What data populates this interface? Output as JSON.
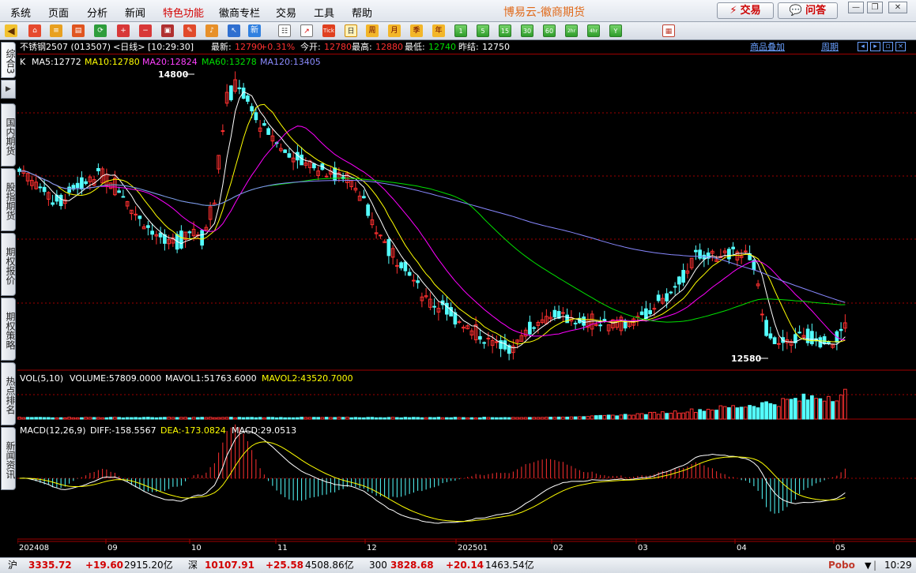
{
  "menu": [
    "系统",
    "页面",
    "分析",
    "新闻",
    "特色功能",
    "徽商专栏",
    "交易",
    "工具",
    "帮助"
  ],
  "menu_highlight": "特色功能",
  "app_title": "博易云-徽商期货",
  "top_buttons": {
    "trade": "交易",
    "ask": "问答"
  },
  "toolbar": {
    "periods": [
      "日",
      "周",
      "月",
      "季",
      "年",
      "1",
      "5",
      "15",
      "30",
      "60",
      "2hr",
      "4hr",
      "Y"
    ],
    "active_period": "日",
    "tick_label": "Tick",
    "new_label": "新"
  },
  "side_tabs": [
    "综合3",
    "国内期货",
    "股指期货",
    "期权报价",
    "期权策略",
    "热点排名",
    "新闻资讯"
  ],
  "quote": {
    "name": "不锈钢2507 (013507)",
    "period": "<日线>",
    "time": "[10:29:30]",
    "latest_label": "最新:",
    "latest": "12790",
    "change": "+0.31%",
    "open_label": "今开:",
    "open": "12780",
    "high_label": "最高:",
    "high": "12880",
    "low_label": "最低:",
    "low": "12740",
    "prev_label": "昨结:",
    "prev": "12750",
    "overlay_link": "商品叠加",
    "period_link": "周期"
  },
  "ma": {
    "k": "K",
    "ma5": "MA5:12772",
    "ma10": "MA10:12780",
    "ma20": "MA20:12824",
    "ma60": "MA60:13278",
    "ma120": "MA120:13405"
  },
  "volume": {
    "title": "VOL(5,10)",
    "volume": "VOLUME:57809.0000",
    "mavol1": "MAVOL1:51763.6000",
    "mavol2": "MAVOL2:43520.7000"
  },
  "macd": {
    "title": "MACD(12,26,9)",
    "diff": "DIFF:-158.5567",
    "dea": "DEA:-173.0824",
    "macd": "MACD:29.0513"
  },
  "annotations": {
    "high": "14800",
    "low": "12580"
  },
  "colors": {
    "up": "#ff3030",
    "down": "#54ffff",
    "ma5": "#ffffff",
    "ma10": "#ffff00",
    "ma20": "#ff00ff",
    "ma60": "#00e000",
    "ma120": "#8888ff",
    "grid": "#a00000"
  },
  "chart_data": {
    "type": "candlestick",
    "x_labels": [
      "202408",
      "09",
      "10",
      "11",
      "12",
      "202501",
      "02",
      "03",
      "04",
      "05"
    ],
    "price_high": 14800,
    "price_low": 12580,
    "ma_latest": {
      "MA5": 12772,
      "MA10": 12780,
      "MA20": 12824,
      "MA60": 13278,
      "MA120": 13405
    },
    "latest_bar": {
      "open": 12780,
      "high": 12880,
      "low": 12740,
      "close": 12790
    },
    "close_path": [
      14050,
      13950,
      13900,
      13780,
      13820,
      13900,
      13950,
      14000,
      13920,
      13850,
      13700,
      13600,
      13500,
      13450,
      13480,
      13550,
      13500,
      13800,
      14600,
      14750,
      14600,
      14400,
      14300,
      14200,
      14150,
      14100,
      14050,
      14020,
      14000,
      13950,
      13800,
      13550,
      13450,
      13300,
      13200,
      13050,
      12950,
      12950,
      12850,
      12780,
      12700,
      12650,
      12600,
      12600,
      12720,
      12800,
      12840,
      12860,
      12840,
      12810,
      12800,
      12780,
      12790,
      12800,
      12820,
      12900,
      13000,
      13050,
      13200,
      13350,
      13350,
      13350,
      13350,
      13380,
      13300,
      12800,
      12600,
      12650,
      12700,
      12700,
      12650,
      12650,
      12790
    ]
  },
  "status": {
    "sh_label": "沪",
    "sh_value": "3335.72",
    "sh_change": "+19.60",
    "sh_amount": "2915.20亿",
    "sz_label": "深",
    "sz_value": "10107.91",
    "sz_change": "+25.58",
    "sz_amount": "4508.86亿",
    "i300_label": "300",
    "i300_value": "3828.68",
    "i300_change": "+20.14",
    "i300_amount": "1463.54亿",
    "brand": "Pobo",
    "clock": "10:29"
  }
}
